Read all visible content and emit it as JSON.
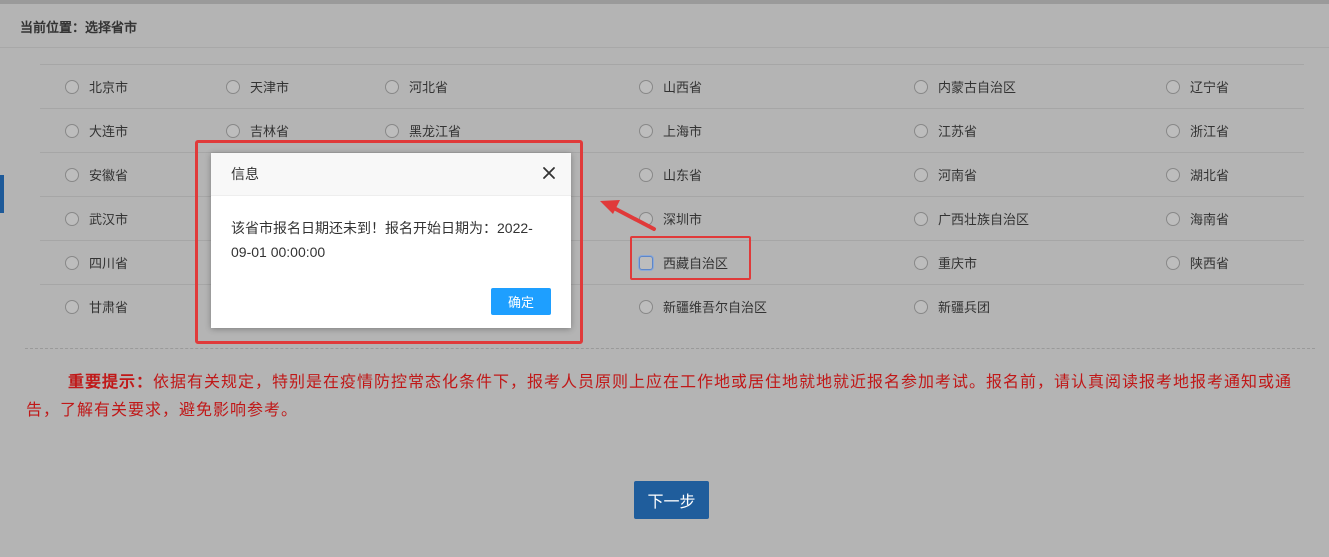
{
  "breadcrumb": "当前位置：选择省市",
  "regions": [
    [
      "北京市",
      "天津市",
      "河北省",
      "山西省",
      "内蒙古自治区",
      "辽宁省"
    ],
    [
      "大连市",
      "吉林省",
      "黑龙江省",
      "上海市",
      "江苏省",
      "浙江省"
    ],
    [
      "安徽省",
      "",
      "",
      "山东省",
      "河南省",
      "湖北省"
    ],
    [
      "武汉市",
      "",
      "",
      "深圳市",
      "广西壮族自治区",
      "海南省"
    ],
    [
      "四川省",
      "",
      "",
      "西藏自治区",
      "重庆市",
      "陕西省"
    ],
    [
      "甘肃省",
      "",
      "",
      "新疆维吾尔自治区",
      "新疆兵团",
      ""
    ]
  ],
  "notice": {
    "title": "重要提示：",
    "text": "依据有关规定，特别是在疫情防控常态化条件下，报考人员原则上应在工作地或居住地就地就近报名参加考试。报名前，请认真阅读报考地报考通知或通告，了解有关要求，避免影响参考。"
  },
  "next_button": "下一步",
  "dialog": {
    "title": "信息",
    "message": "该省市报名日期还未到！报名开始日期为：2022-09-01 00:00:00",
    "ok_button": "确定"
  },
  "colors": {
    "overlay": "#b4b4b4",
    "accent": "#1e9fff",
    "primary": "#1f5d9c",
    "notice_text": "#c01818",
    "annotation": "#e03a3a"
  }
}
